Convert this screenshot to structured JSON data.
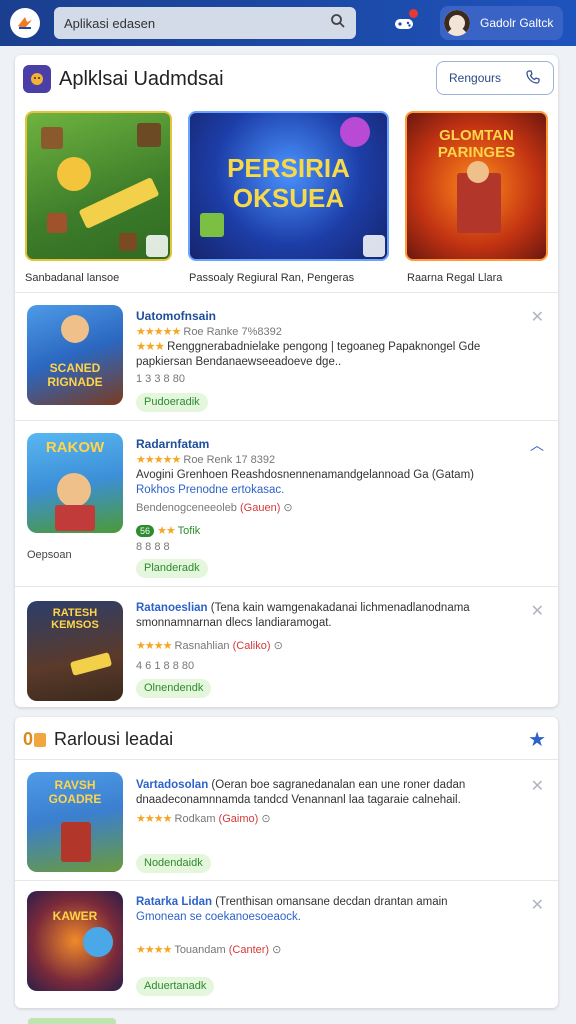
{
  "topbar": {
    "logo_icon": "app-logo-icon",
    "search_value": "Aplikasi edasen",
    "search_icon": "search-icon",
    "notification_icon": "gamepad-notification-icon",
    "user_name": "Gadolr Galtck",
    "accent": "#1c4aa8"
  },
  "section1": {
    "title": "Aplklsai Uadmdsai",
    "button_label": "Rengours",
    "featured": [
      {
        "label": "Sanbadanal lansoe",
        "art_text": ""
      },
      {
        "label": "Passoaly Regiural Ran, Pengeras",
        "art_text": "PERSIRIA OKSUEA"
      },
      {
        "label": "Raarna Regal Llara",
        "art_text": "GLOMTAN PARINGES"
      }
    ],
    "list": [
      {
        "title": "Uatomofnsain",
        "meta_rating": "Roe Ranke 7%8392",
        "description": "Renggnerabadnielake pengong | tegoaneg Papaknongel Gde papkiersan Bendanaewseeadoeve dge..",
        "meta": "1 3 3 8 80",
        "status": "Pudoeradik",
        "thumb_text": "SCANED RIGNADE"
      },
      {
        "title": "Radarnfatam",
        "meta_rating": "Roe Renk 17 8392",
        "description": "Avogini Grenhoen Reashdosnennenamandgelannoad Ga (Gatam)",
        "description2": "Rokhos Prenodne ertokasac.",
        "meta": "Bendenogceneeoleb",
        "meta_tag": "(Gauen)",
        "chip": "56",
        "chip_label": "Tofik",
        "meta2": "8 8 8 8",
        "caption": "Oepsoan",
        "status": "Planderadk",
        "thumb_text": "RAKOW"
      },
      {
        "title": "Ratanoeslian",
        "description": "(Tena kain wamgenakadanai lichmenadlanodnama smonnamnarnan dlecs landiaramogat.",
        "meta_rating": "Rasnahlian",
        "meta_tag": "(Caliko)",
        "meta": "4 6 1 8 8 80",
        "status": "Olnendendk",
        "thumb_text": "RATESH KEMSOS"
      }
    ]
  },
  "section2": {
    "title": "Rarlousi leadai",
    "star_icon": "star-icon",
    "list": [
      {
        "title": "Vartadosolan",
        "description": "(Oeran boe sagranedanalan ean une roner dadan dnaadeconamnnamda tandcd Venannanl laa tagaraie calnehail.",
        "meta_rating": "Rodkam",
        "meta_tag": "(Gaimo)",
        "meta": "",
        "status": "Nodendaidk",
        "thumb_text": "RAVSH GOADRE"
      },
      {
        "title": "Ratarka Lidan",
        "description": "(Trenthisan omansane decdan drantan amain",
        "description2": "Gmonean se coekanoesoeaock.",
        "meta_rating": "Touandam",
        "meta_tag": "(Canter)",
        "meta": "",
        "status": "Aduertanadk",
        "thumb_text": "KAWER"
      }
    ]
  }
}
